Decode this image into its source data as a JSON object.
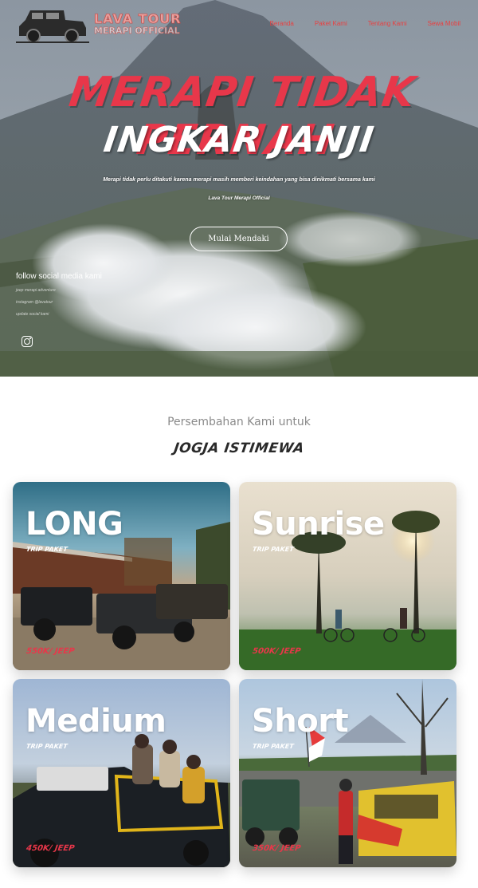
{
  "brand": {
    "name": "LAVA TOUR",
    "sub": "MERAPI OFFICIAL"
  },
  "nav": {
    "items": [
      "Beranda",
      "Paket Kami",
      "Tentang Kami",
      "Sewa Mobil"
    ]
  },
  "hero": {
    "headline_1": "MERAPI TIDAK PERNAH",
    "headline_2": "INGKAR JANJI",
    "subtitle": "Merapi tidak perlu ditakuti karena merapi masih memberi keindahan yang bisa dinikmati bersama kami",
    "brandline": "Lava Tour Merapi Official",
    "cta_label": "Mulai Mendaki"
  },
  "social": {
    "title": "follow social media kami",
    "lines": [
      "jeep merapi adventure",
      "instagram @lavatour",
      "update social kami"
    ],
    "icon": "instagram-icon"
  },
  "section": {
    "subtitle": "Persembahan Kami untuk",
    "title": "JOGJA ISTIMEWA"
  },
  "packages": [
    {
      "title": "LONG",
      "tag": "TRIP PAKET",
      "price": "550K/ JEEP"
    },
    {
      "title": "Sunrise",
      "tag": "TRIP PAKET",
      "price": "500K/ JEEP"
    },
    {
      "title": "Medium",
      "tag": "TRIP PAKET",
      "price": "450K/ JEEP"
    },
    {
      "title": "Short",
      "tag": "TRIP PAKET",
      "price": "350K/ JEEP"
    }
  ],
  "colors": {
    "accent": "#e8374a",
    "nav_link": "#e84040",
    "section_sub": "#8a8a8a"
  }
}
